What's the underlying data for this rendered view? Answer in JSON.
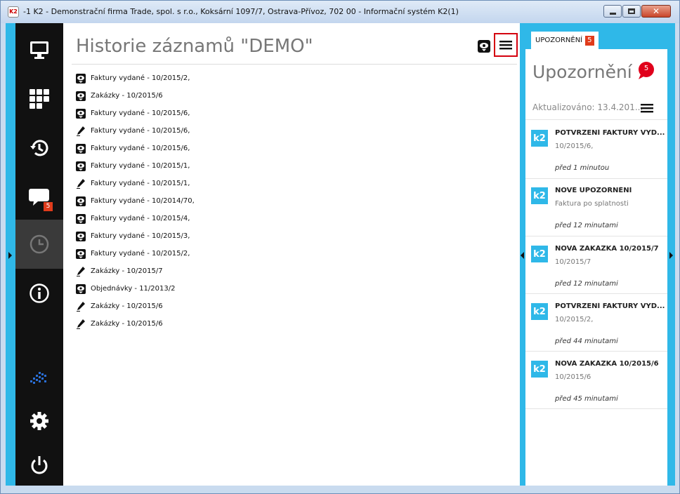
{
  "window": {
    "title": "-1 K2 - Demonstrační firma Trade, spol. s r.o., Koksární 1097/7, Ostrava-Přívoz, 702 00 - Informační systém K2(1)",
    "app_icon": "K2",
    "minimize_icon": "minimize-icon",
    "maximize_icon": "maximize-icon",
    "close_glyph": "✕"
  },
  "sidebar": {
    "accent_color": "#2fb8e8",
    "background": "#111111",
    "items": [
      {
        "icon": "monitor-icon"
      },
      {
        "icon": "apps-grid-icon"
      },
      {
        "icon": "history-icon"
      },
      {
        "icon": "chat-icon",
        "badge": "5"
      },
      {
        "icon": "clock-icon",
        "active": true
      },
      {
        "icon": "info-icon"
      },
      {
        "icon": "k2-logo-icon"
      },
      {
        "icon": "gear-icon"
      },
      {
        "icon": "power-icon"
      }
    ]
  },
  "main": {
    "title": "Historie záznamů \"DEMO\"",
    "header_icons": [
      "view-icon",
      "menu-icon"
    ],
    "history": [
      {
        "icon": "view-icon",
        "text": "Faktury vydané - 10/2015/2,"
      },
      {
        "icon": "view-icon",
        "text": "Zakázky - 10/2015/6"
      },
      {
        "icon": "view-icon",
        "text": "Faktury vydané - 10/2015/6,"
      },
      {
        "icon": "edit-icon",
        "text": "Faktury vydané - 10/2015/6,"
      },
      {
        "icon": "view-icon",
        "text": "Faktury vydané - 10/2015/6,"
      },
      {
        "icon": "view-icon",
        "text": "Faktury vydané - 10/2015/1,"
      },
      {
        "icon": "edit-icon",
        "text": "Faktury vydané - 10/2015/1,"
      },
      {
        "icon": "view-icon",
        "text": "Faktury vydané - 10/2014/70,"
      },
      {
        "icon": "view-icon",
        "text": "Faktury vydané - 10/2015/4,"
      },
      {
        "icon": "view-icon",
        "text": "Faktury vydané - 10/2015/3,"
      },
      {
        "icon": "view-icon",
        "text": "Faktury vydané - 10/2015/2,"
      },
      {
        "icon": "edit-icon",
        "text": "Zakázky - 10/2015/7"
      },
      {
        "icon": "view-icon",
        "text": "Objednávky - 11/2013/2"
      },
      {
        "icon": "edit-icon",
        "text": "Zakázky - 10/2015/6"
      },
      {
        "icon": "edit-icon",
        "text": "Zakázky - 10/2015/6"
      }
    ]
  },
  "panel": {
    "tab_label": "UPOZORNĚNÍ",
    "tab_badge": "5",
    "title": "Upozornění",
    "title_badge": "5",
    "updated": "Aktualizováno: 13.4.201...",
    "notifications": [
      {
        "badge": "k2",
        "heading": "POTVRZENÍ FAKTURY VYD...",
        "sub": "10/2015/6,",
        "time": "před 1 minutou"
      },
      {
        "badge": "k2",
        "heading": "NOVÉ UPOZORNĚNÍ",
        "sub": "Faktura po splatnosti",
        "time": "před 12 minutami"
      },
      {
        "badge": "k2",
        "heading": "NOVÁ ZAKÁZKA 10/2015/7",
        "sub": "10/2015/7",
        "time": "před 12 minutami"
      },
      {
        "badge": "k2",
        "heading": "POTVRZENÍ FAKTURY VYD...",
        "sub": "10/2015/2,",
        "time": "před 44 minutami"
      },
      {
        "badge": "k2",
        "heading": "NOVÁ ZAKÁZKA 10/2015/6",
        "sub": "10/2015/6",
        "time": "před 45 minutami"
      }
    ],
    "accent_color": "#2fb8e8",
    "badge_color": "#e03b1b"
  }
}
